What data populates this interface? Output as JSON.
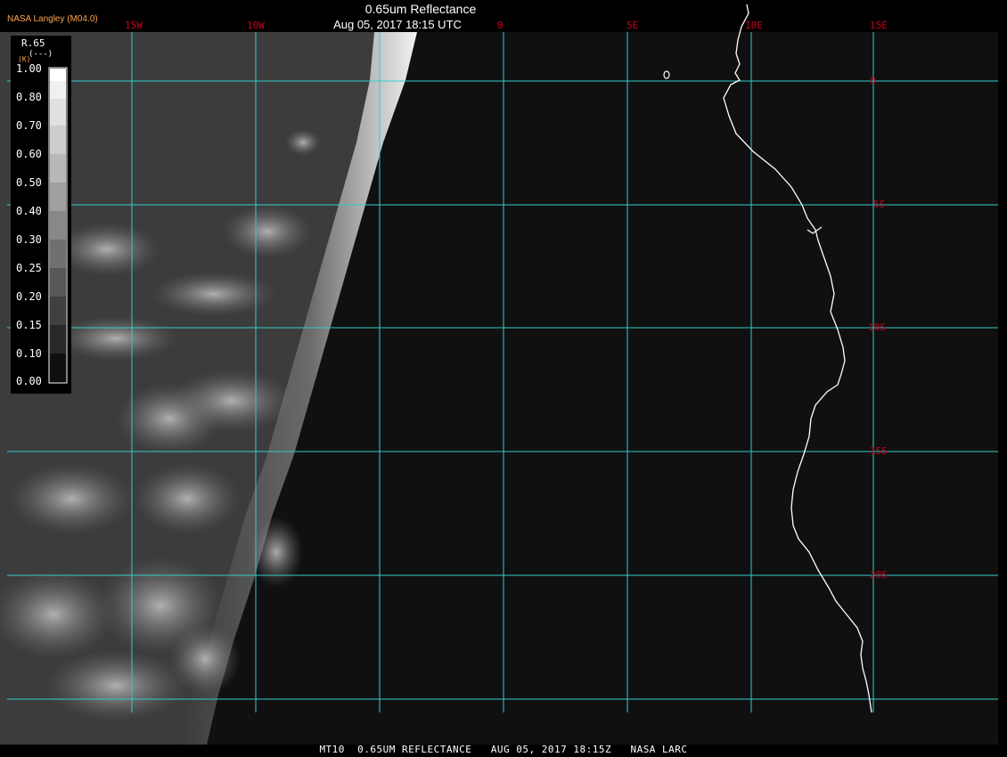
{
  "header": {
    "brand": "NASA Langley (M04.0)",
    "title": "0.65um Reflectance",
    "subtitle": "Aug 05, 2017 18:15 UTC"
  },
  "legend": {
    "variable": "R.65",
    "unit": "(---)",
    "unit_prefix": "(K)",
    "ticks": [
      "1.00",
      "0.80",
      "0.70",
      "0.60",
      "0.50",
      "0.40",
      "0.30",
      "0.25",
      "0.20",
      "0.15",
      "0.10",
      "0.00"
    ]
  },
  "grid": {
    "longitudes": [
      "15W",
      "10W",
      "0",
      "5E",
      "10E",
      "15E"
    ],
    "latitudes": [
      "0",
      "5S",
      "10S",
      "15S",
      "20S"
    ],
    "color": "#33cccc",
    "label_color": "#c8001e"
  },
  "footer": "MT10  0.65UM REFLECTANCE   AUG 05, 2017 18:15Z   NASA LARC",
  "colors": {
    "background": "#000000",
    "ocean": "#101010",
    "coastline": "#ffffff",
    "brand": "#ffa54a"
  }
}
